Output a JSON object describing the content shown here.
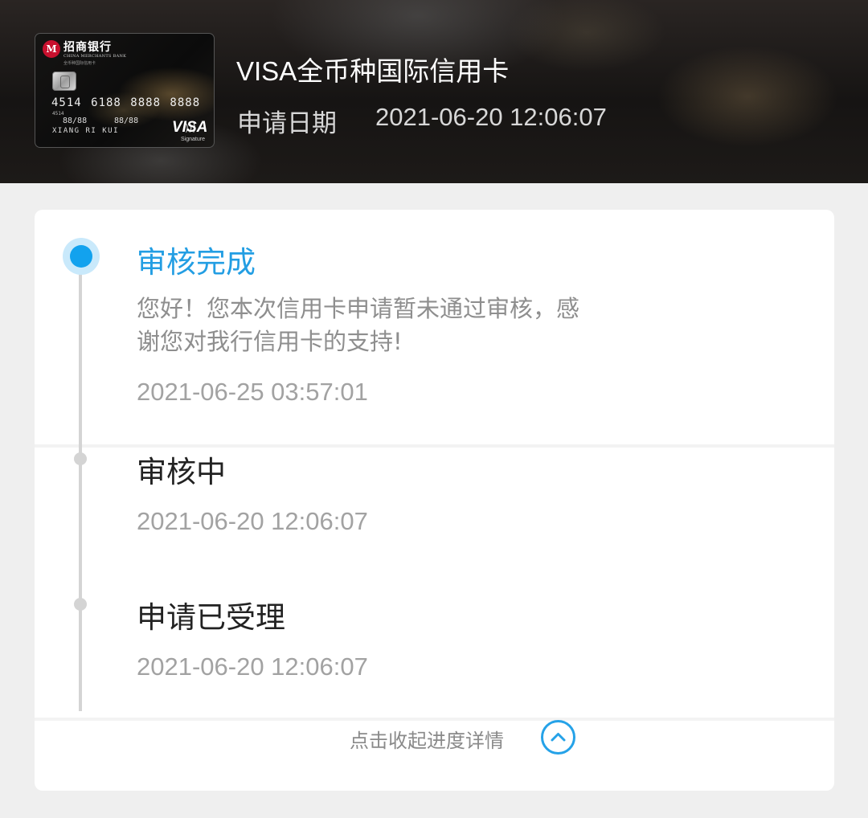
{
  "card": {
    "bank_name_cn": "招商银行",
    "bank_name_en": "CHINA MERCHANTS BANK",
    "sub_title": "全币种国际信用卡",
    "number": "4514 6188 8888 8888",
    "number_prefix": "4514",
    "valid_from": "88/88",
    "valid_thru": "88/88",
    "holder_name": "XIANG RI KUI",
    "network": "VISA",
    "network_tier": "Signature"
  },
  "header": {
    "card_title": "VISA全币种国际信用卡",
    "apply_label": "申请日期",
    "apply_date": "2021-06-20 12:06:07"
  },
  "timeline": {
    "active_color": "#12a2ee",
    "steps": [
      {
        "title": "审核完成",
        "message": "您好！您本次信用卡申请暂未通过审核，感谢您对我行信用卡的支持!",
        "time": "2021-06-25 03:57:01"
      },
      {
        "title": "审核中",
        "time": "2021-06-20 12:06:07"
      },
      {
        "title": "申请已受理",
        "time": "2021-06-20 12:06:07"
      }
    ]
  },
  "footer": {
    "collapse_label": "点击收起进度详情",
    "collapse_icon": "chevron-up-circle-icon"
  }
}
